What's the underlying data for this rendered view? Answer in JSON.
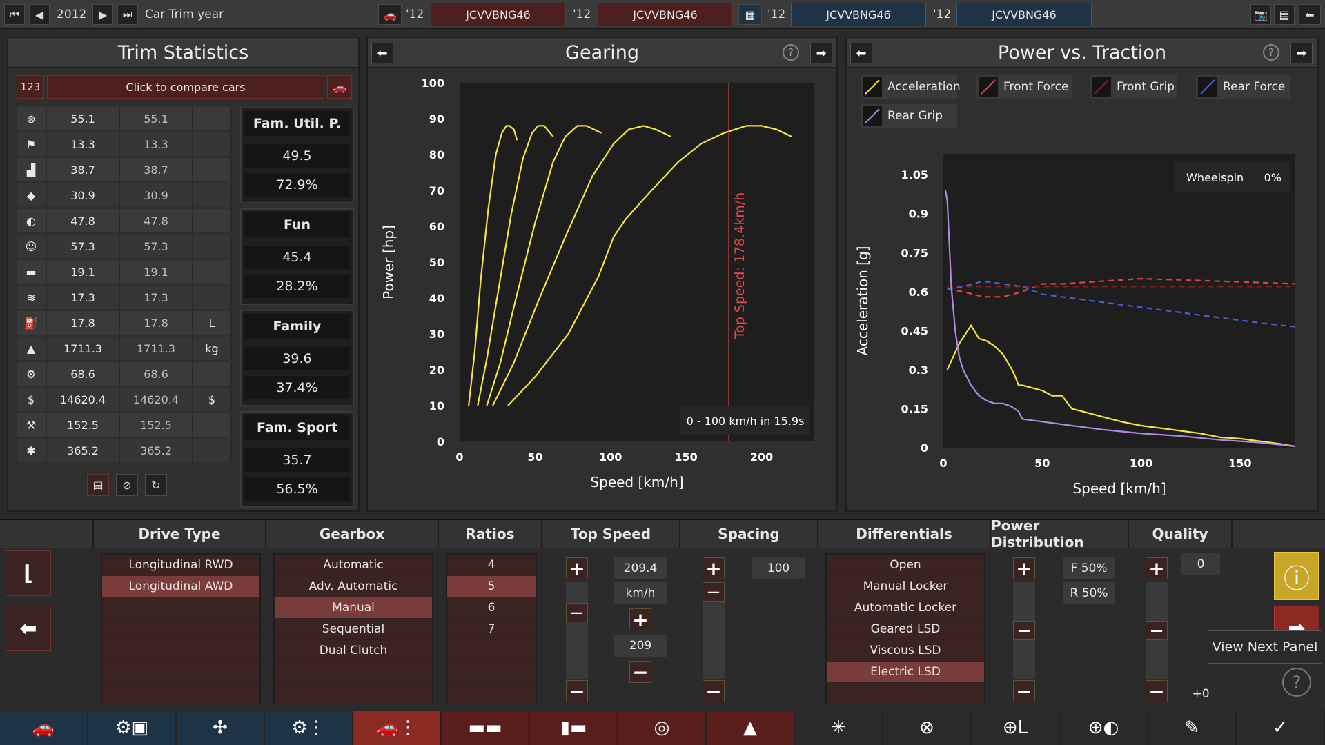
{
  "topbar": {
    "year": "2012",
    "mode_label": "Car Trim year",
    "slots": [
      {
        "year": "'12",
        "name": "JCVVBNG46"
      },
      {
        "year": "'12",
        "name": "JCVVBNG46"
      },
      {
        "year": "'12",
        "name": "JCVVBNG46"
      },
      {
        "year": "'12",
        "name": "JCVVBNG46"
      }
    ]
  },
  "trim": {
    "title": "Trim Statistics",
    "compare_id": "123",
    "compare_label": "Click to compare cars",
    "rows": [
      {
        "icon": "steering-wheel-icon",
        "v1": "55.1",
        "v2": "55.1",
        "unit": ""
      },
      {
        "icon": "race-flag-icon",
        "v1": "13.3",
        "v2": "13.3",
        "unit": ""
      },
      {
        "icon": "seat-icon",
        "v1": "38.7",
        "v2": "38.7",
        "unit": ""
      },
      {
        "icon": "diamond-icon",
        "v1": "30.9",
        "v2": "30.9",
        "unit": ""
      },
      {
        "icon": "safety-icon",
        "v1": "47.8",
        "v2": "47.8",
        "unit": ""
      },
      {
        "icon": "passengers-icon",
        "v1": "57.3",
        "v2": "57.3",
        "unit": ""
      },
      {
        "icon": "cargo-car-icon",
        "v1": "19.1",
        "v2": "19.1",
        "unit": ""
      },
      {
        "icon": "offroad-car-icon",
        "v1": "17.3",
        "v2": "17.3",
        "unit": ""
      },
      {
        "icon": "fuel-icon",
        "v1": "17.8",
        "v2": "17.8",
        "unit": "L"
      },
      {
        "icon": "weight-icon",
        "v1": "1711.3",
        "v2": "1711.3",
        "unit": "kg"
      },
      {
        "icon": "service-icon",
        "v1": "68.6",
        "v2": "68.6",
        "unit": ""
      },
      {
        "icon": "cost-icon",
        "v1": "14620.4",
        "v2": "14620.4",
        "unit": "$"
      },
      {
        "icon": "production-icon",
        "v1": "152.5",
        "v2": "152.5",
        "unit": ""
      },
      {
        "icon": "engineering-icon",
        "v1": "365.2",
        "v2": "365.2",
        "unit": ""
      }
    ],
    "scores": [
      {
        "label": "Fam. Util. P.",
        "value": "49.5",
        "percent": "72.9%"
      },
      {
        "label": "Fun",
        "value": "45.4",
        "percent": "28.2%"
      },
      {
        "label": "Family",
        "value": "39.6",
        "percent": "37.4%"
      },
      {
        "label": "Fam. Sport",
        "value": "35.7",
        "percent": "56.5%"
      }
    ]
  },
  "gearing": {
    "title": "Gearing",
    "annotation": "Top Speed: 178.4km/h",
    "accel_note": "0 - 100 km/h in 15.9s"
  },
  "power_traction": {
    "title": "Power vs. Traction",
    "legend": [
      "Acceleration",
      "Front Force",
      "Front Grip",
      "Rear Force",
      "Rear Grip"
    ],
    "wheelspin_label": "Wheelspin",
    "wheelspin_value": "0%"
  },
  "chart_data": [
    {
      "type": "line",
      "title": "Gearing",
      "xlabel": "Speed [km/h]",
      "ylabel": "Power [hp]",
      "xlim": [
        0,
        235
      ],
      "ylim": [
        0,
        100
      ],
      "xticks": [
        0,
        50,
        100,
        150,
        200
      ],
      "yticks": [
        0,
        10,
        20,
        30,
        40,
        50,
        60,
        70,
        80,
        90,
        100
      ],
      "color": "#f4e542",
      "vline": {
        "x": 178.4,
        "color": "#e14b4b"
      },
      "series": [
        {
          "x": [
            6,
            10,
            14,
            19,
            24,
            28,
            31,
            33,
            36,
            38
          ],
          "y": [
            10,
            25,
            45,
            65,
            80,
            86,
            88,
            88,
            87,
            84
          ]
        },
        {
          "x": [
            12,
            18,
            26,
            34,
            42,
            48,
            52,
            56,
            62
          ],
          "y": [
            10,
            23,
            43,
            63,
            79,
            86,
            88,
            88,
            85
          ]
        },
        {
          "x": [
            18,
            27,
            38,
            50,
            62,
            70,
            78,
            84,
            94
          ],
          "y": [
            10,
            22,
            41,
            61,
            78,
            85,
            88,
            88,
            86
          ]
        },
        {
          "x": [
            22,
            36,
            52,
            70,
            88,
            102,
            112,
            122,
            130,
            140
          ],
          "y": [
            10,
            22,
            39,
            57,
            74,
            83,
            87,
            88,
            87,
            85
          ]
        },
        {
          "x": [
            32,
            50,
            72,
            92,
            102,
            110,
            125,
            145,
            160,
            175,
            190,
            200,
            210,
            220
          ],
          "y": [
            10,
            18,
            30,
            46,
            57,
            62,
            69,
            78,
            83,
            86,
            88,
            88,
            87,
            85
          ]
        }
      ]
    },
    {
      "type": "line",
      "title": "Power vs. Traction",
      "xlabel": "Speed [km/h]",
      "ylabel": "Acceleration [g]",
      "xlim": [
        0,
        178
      ],
      "ylim": [
        0,
        1.13
      ],
      "xticks": [
        0,
        50,
        100,
        150
      ],
      "yticks": [
        0,
        0.15,
        0.3,
        0.45,
        0.6,
        0.75,
        0.9,
        1.05
      ],
      "series": [
        {
          "name": "Acceleration",
          "color": "#f4e542",
          "dash": false,
          "x": [
            2,
            8,
            14,
            18,
            22,
            26,
            30,
            34,
            36,
            38,
            40,
            45,
            50,
            55,
            60,
            65,
            70,
            80,
            90,
            100,
            110,
            120,
            130,
            140,
            150,
            160,
            170,
            178
          ],
          "y": [
            0.3,
            0.4,
            0.47,
            0.42,
            0.41,
            0.39,
            0.36,
            0.31,
            0.28,
            0.24,
            0.24,
            0.23,
            0.22,
            0.2,
            0.2,
            0.15,
            0.14,
            0.12,
            0.1,
            0.085,
            0.075,
            0.065,
            0.055,
            0.04,
            0.035,
            0.025,
            0.015,
            0.005
          ]
        },
        {
          "name": "Front Force",
          "color": "#e04545",
          "dash": true,
          "x": [
            2,
            10,
            20,
            30,
            40,
            50,
            60,
            80,
            100,
            120,
            140,
            160,
            178
          ],
          "y": [
            0.61,
            0.6,
            0.58,
            0.58,
            0.6,
            0.63,
            0.63,
            0.64,
            0.65,
            0.645,
            0.64,
            0.635,
            0.63
          ]
        },
        {
          "name": "Front Grip",
          "color": "#8b2020",
          "dash": true,
          "x": [
            2,
            178
          ],
          "y": [
            0.62,
            0.62
          ]
        },
        {
          "name": "Rear Force",
          "color": "#4a5fd8",
          "dash": true,
          "x": [
            2,
            10,
            20,
            30,
            40,
            50,
            60,
            80,
            100,
            120,
            140,
            160,
            178
          ],
          "y": [
            0.61,
            0.62,
            0.64,
            0.63,
            0.62,
            0.59,
            0.58,
            0.56,
            0.54,
            0.52,
            0.5,
            0.48,
            0.465
          ]
        },
        {
          "name": "Rear Grip",
          "color": "#b088e0",
          "dash": false,
          "x": [
            1,
            2,
            4,
            6,
            8,
            10,
            14,
            18,
            22,
            26,
            30,
            34,
            38,
            40,
            50,
            60,
            70,
            80,
            100,
            120,
            140,
            160,
            178
          ],
          "y": [
            0.99,
            0.95,
            0.62,
            0.45,
            0.35,
            0.3,
            0.24,
            0.2,
            0.18,
            0.17,
            0.17,
            0.16,
            0.14,
            0.11,
            0.1,
            0.09,
            0.08,
            0.07,
            0.055,
            0.045,
            0.03,
            0.02,
            0.005
          ]
        }
      ]
    }
  ],
  "bottom": {
    "headers": [
      "Drive Type",
      "Gearbox",
      "Ratios",
      "Top Speed",
      "Spacing",
      "Differentials",
      "Power Distribution",
      "Quality"
    ],
    "drive_types": [
      {
        "label": "Longitudinal RWD",
        "selected": false
      },
      {
        "label": "Longitudinal AWD",
        "selected": true
      }
    ],
    "gearboxes": [
      {
        "label": "Automatic",
        "selected": false
      },
      {
        "label": "Adv. Automatic",
        "selected": false
      },
      {
        "label": "Manual",
        "selected": true
      },
      {
        "label": "Sequential",
        "selected": false
      },
      {
        "label": "Dual Clutch",
        "selected": false
      }
    ],
    "ratios": [
      {
        "label": "4",
        "selected": false
      },
      {
        "label": "5",
        "selected": true
      },
      {
        "label": "6",
        "selected": false
      },
      {
        "label": "7",
        "selected": false
      }
    ],
    "top_speed": {
      "value": "209.4",
      "unit": "km/h",
      "target": "209"
    },
    "spacing": {
      "value": "100"
    },
    "differentials": [
      {
        "label": "Open",
        "selected": false
      },
      {
        "label": "Manual Locker",
        "selected": false
      },
      {
        "label": "Automatic Locker",
        "selected": false
      },
      {
        "label": "Geared LSD",
        "selected": false
      },
      {
        "label": "Viscous LSD",
        "selected": false
      },
      {
        "label": "Electric LSD",
        "selected": true
      }
    ],
    "power_dist": {
      "front": "F 50%",
      "rear": "R 50%"
    },
    "quality": {
      "value": "0",
      "delta": "+0"
    },
    "tooltip": "View Next Panel"
  },
  "nav": {
    "items": [
      "car-body-icon",
      "chassis-icon",
      "suspension-icon",
      "drivetrain-icon",
      "gearbox-icon",
      "interior-icon",
      "fixtures-icon",
      "brakes-icon",
      "tyres-icon",
      "wheels-icon",
      "aero-icon",
      "steering-icon",
      "safety-icon",
      "testing-icon",
      "done-icon"
    ]
  }
}
